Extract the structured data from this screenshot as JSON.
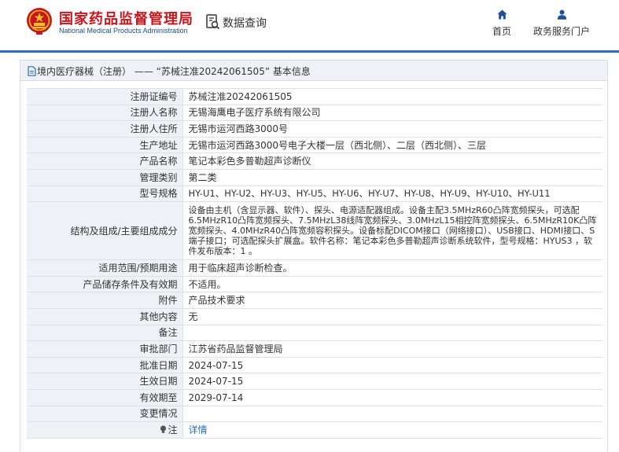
{
  "header": {
    "title_cn": "国家药品监督管理局",
    "title_en": "National Medical Products Administration",
    "query_label": "数据查询",
    "nav": [
      {
        "label": "首页",
        "icon": "home-icon"
      },
      {
        "label": "政务服务门户",
        "icon": "user-icon"
      }
    ]
  },
  "colors": {
    "accent": "#2a6cc0",
    "brand_red": "#c8161e",
    "key_bg": "#eef2f7"
  },
  "panel": {
    "title": "境内医疗器械（注册） —— “苏械注准20242061505” 基本信息"
  },
  "rows": [
    {
      "key": "注册证编号",
      "value": "苏械注准20242061505"
    },
    {
      "key": "注册人名称",
      "value": "无锡海鹰电子医疗系统有限公司"
    },
    {
      "key": "注册人住所",
      "value": "无锡市运河西路3000号"
    },
    {
      "key": "生产地址",
      "value": "无锡市运河西路3000号电子大楼一层（西北侧）、二层（西北侧）、三层"
    },
    {
      "key": "产品名称",
      "value": "笔记本彩色多普勒超声诊断仪"
    },
    {
      "key": "管理类别",
      "value": "第二类"
    },
    {
      "key": "型号规格",
      "value": "HY-U1、HY-U2、HY-U3、HY-U5、HY-U6、HY-U7、HY-U8、HY-U9、HY-U10、HY-U11"
    },
    {
      "key": "结构及组成/主要组成成分",
      "value": "设备由主机（含显示器、软件）、探头、电源适配器组成。设备主配3.5MHzR60凸阵宽频探头，可选配6.5MHzR10凸阵宽频探头、7.5MHzL38线阵宽频探头、3.0MHzL15相控阵宽频探头、6.5MHzR10K凸阵宽频探头、4.0MHzR40凸阵宽频容积探头。设备标配DICOM接口（网络接口）、USB接口、HDMI接口、S端子接口；可选配探头扩展盒。软件名称：笔记本彩色多普勒超声诊断系统软件，型号规格：HYUS3 ，软件发布版本：1 。"
    },
    {
      "key": "适用范围/预期用途",
      "value": "用于临床超声诊断检查。"
    },
    {
      "key": "产品储存条件及有效期",
      "value": "不适用。"
    },
    {
      "key": "附件",
      "value": "产品技术要求"
    },
    {
      "key": "其他内容",
      "value": "无"
    },
    {
      "key": "备注",
      "value": ""
    },
    {
      "key": "审批部门",
      "value": "江苏省药品监督管理局"
    },
    {
      "key": "批准日期",
      "value": "2024-07-15"
    },
    {
      "key": "生效日期",
      "value": "2024-07-15"
    },
    {
      "key": "有效期至",
      "value": "2029-07-14"
    },
    {
      "key": "变更情况",
      "value": ""
    }
  ],
  "note_row": {
    "key": "注",
    "value": "详情",
    "icon": "lightbulb-icon"
  }
}
